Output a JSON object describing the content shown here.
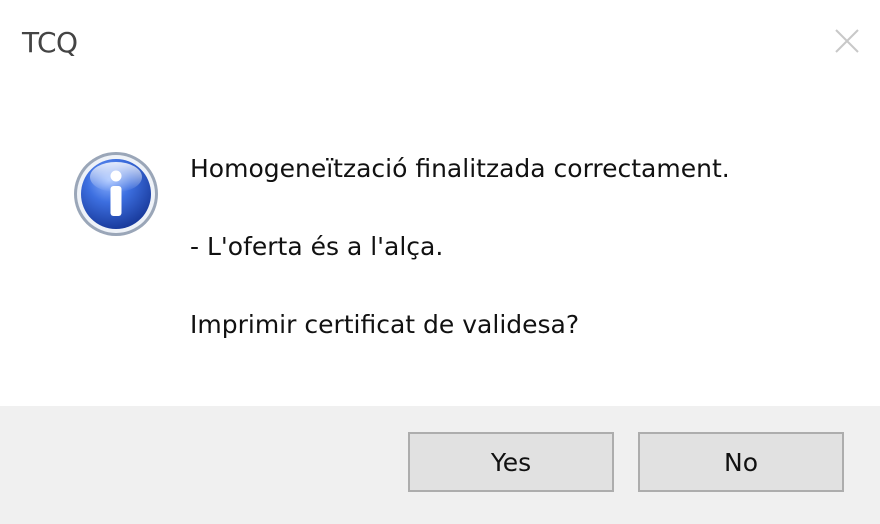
{
  "window": {
    "title": "TCQ"
  },
  "icons": {
    "close": "close-icon",
    "info": "info-icon"
  },
  "message": {
    "line1": "Homogeneïtzació finalitzada correctament.",
    "line2": "- L'oferta és a l'alça.",
    "line3": "Imprimir certificat de validesa?"
  },
  "buttons": {
    "yes": "Yes",
    "no": "No"
  },
  "colors": {
    "icon_blue": "#2f5fd0",
    "footer_bg": "#f0f0f0",
    "button_bg": "#e1e1e1"
  }
}
